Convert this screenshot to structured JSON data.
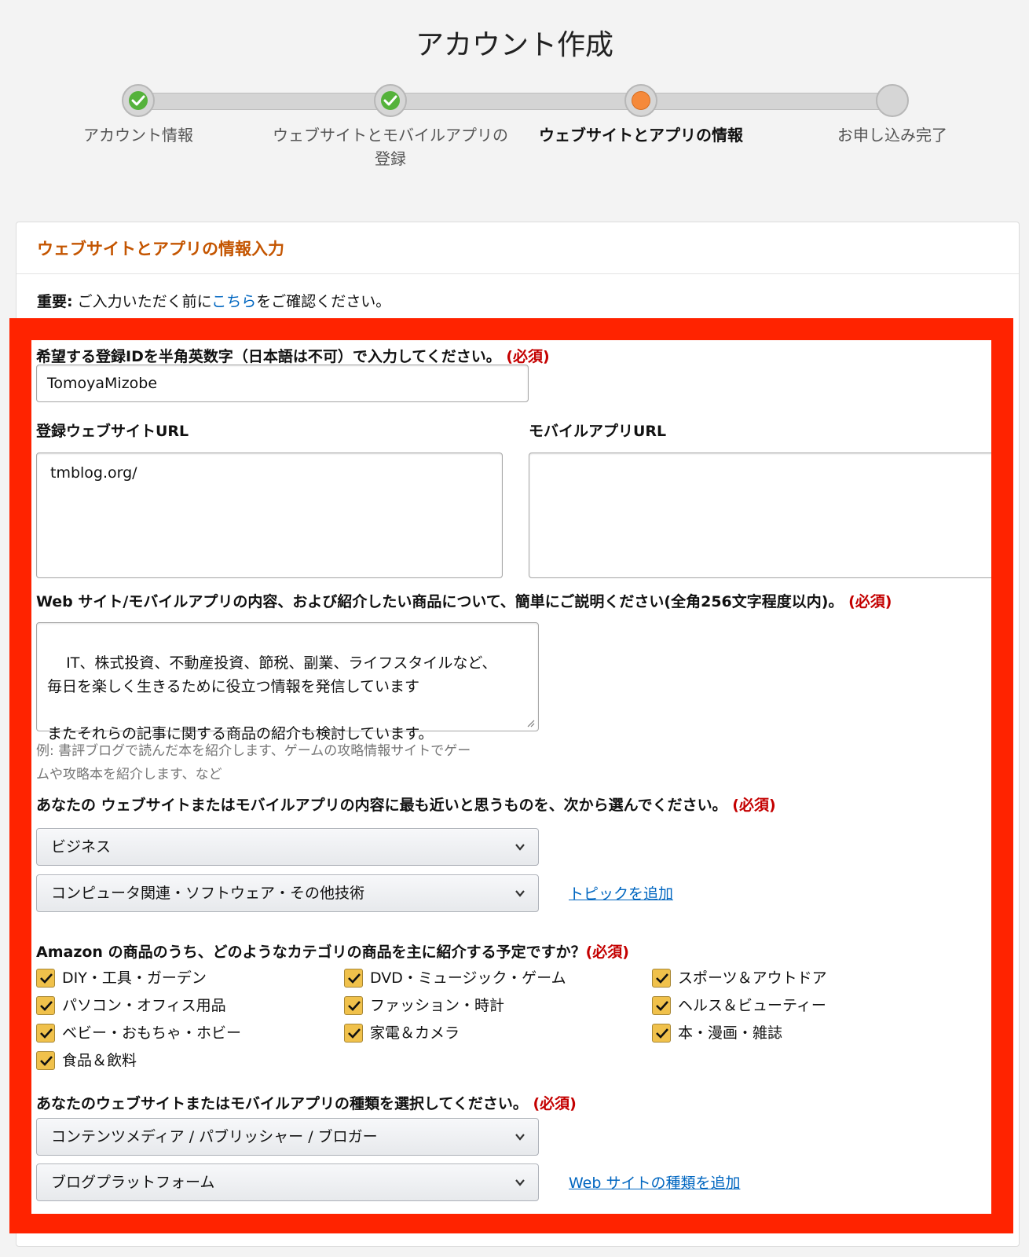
{
  "page": {
    "title": "アカウント作成"
  },
  "stepper": {
    "steps": [
      {
        "label": "アカウント情報",
        "state": "done"
      },
      {
        "label": "ウェブサイトとモバイルアプリの登録",
        "state": "done"
      },
      {
        "label": "ウェブサイトとアプリの情報",
        "state": "current"
      },
      {
        "label": "お申し込み完了",
        "state": "pending"
      }
    ]
  },
  "panel": {
    "title": "ウェブサイトとアプリの情報入力",
    "notice": {
      "prefix": "重要:",
      "text_before": " ご入力いただく前に",
      "link": "こちら",
      "text_after": "をご確認ください。"
    }
  },
  "form": {
    "required_mark": "(必須)",
    "store_id": {
      "label": "希望する登録IDを半角英数字（日本語は不可）で入力してください。",
      "value": "TomoyaMizobe"
    },
    "website_url": {
      "label": "登録ウェブサイトURL",
      "value": "tmblog.org/"
    },
    "mobile_url": {
      "label": "モバイルアプリURL",
      "value": ""
    },
    "description": {
      "label": "Web サイト/モバイルアプリの内容、および紹介したい商品について、簡単にご説明ください(全角256文字程度以内)。",
      "value": "IT、株式投資、不動産投資、節税、副業、ライフスタイルなど、\n毎日を楽しく生きるために役立つ情報を発信しています\n\nまたそれらの記事に関する商品の紹介も検討しています。",
      "hint_line1": "例: 書評ブログで読んだ本を紹介します、ゲームの攻略情報サイトでゲー",
      "hint_line2": "ムや攻略本を紹介します、など"
    },
    "topic": {
      "label": "あなたの ウェブサイトまたはモバイルアプリの内容に最も近いと思うものを、次から選んでください。",
      "primary": "ビジネス",
      "secondary": "コンピュータ関連・ソフトウェア・その他技術",
      "add_link": "トピックを追加"
    },
    "categories": {
      "label": "Amazon の商品のうち、どのようなカテゴリの商品を主に紹介する予定ですか？",
      "items": [
        {
          "label": "DIY・工具・ガーデン",
          "checked": true
        },
        {
          "label": "DVD・ミュージック・ゲーム",
          "checked": true
        },
        {
          "label": "スポーツ＆アウトドア",
          "checked": true
        },
        {
          "label": "パソコン・オフィス用品",
          "checked": true
        },
        {
          "label": "ファッション・時計",
          "checked": true
        },
        {
          "label": "ヘルス＆ビューティー",
          "checked": true
        },
        {
          "label": "ベビー・おもちゃ・ホビー",
          "checked": true
        },
        {
          "label": "家電＆カメラ",
          "checked": true
        },
        {
          "label": "本・漫画・雑誌",
          "checked": true
        },
        {
          "label": "食品＆飲料",
          "checked": true
        }
      ]
    },
    "site_type": {
      "label": "あなたのウェブサイトまたはモバイルアプリの種類を選択してください。",
      "primary": "コンテンツメディア / パブリッシャー / ブロガー",
      "secondary": "ブログプラットフォーム",
      "add_link": "Web サイトの種類を追加"
    }
  },
  "colors": {
    "highlight": "#ff2300",
    "accent_orange": "#c45500",
    "link": "#0066c0",
    "required": "#c40000",
    "checkbox": "#f0c14b",
    "step_done": "#55b23b",
    "step_current": "#f5893a"
  }
}
